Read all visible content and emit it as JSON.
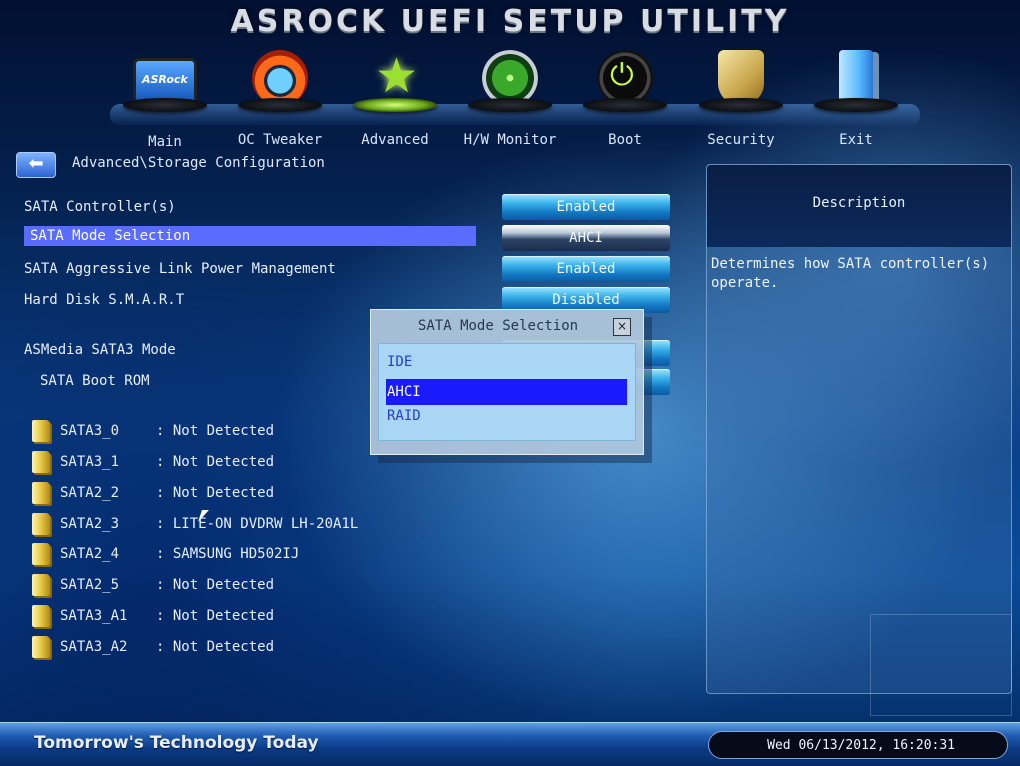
{
  "header": {
    "title": "ASROCK UEFI SETUP UTILITY"
  },
  "nav": [
    {
      "label": "Main",
      "icon": "monitor-icon",
      "badge": "ASRock"
    },
    {
      "label": "OC Tweaker",
      "icon": "speedometer-icon"
    },
    {
      "label": "Advanced",
      "icon": "star-icon",
      "active": true
    },
    {
      "label": "H/W Monitor",
      "icon": "radar-icon"
    },
    {
      "label": "Boot",
      "icon": "power-icon"
    },
    {
      "label": "Security",
      "icon": "shield-icon"
    },
    {
      "label": "Exit",
      "icon": "door-icon"
    }
  ],
  "breadcrumb": "Advanced\\Storage Configuration",
  "settings": [
    {
      "label": "SATA Controller(s)",
      "value": "Enabled"
    },
    {
      "label": "SATA Mode Selection",
      "value": "AHCI"
    },
    {
      "label": "SATA Aggressive Link Power Management",
      "value": "Enabled"
    },
    {
      "label": "Hard Disk S.M.A.R.T",
      "value": "Disabled"
    },
    {
      "label": "ASMedia SATA3 Mode"
    },
    {
      "label": "SATA Boot ROM"
    }
  ],
  "drives": [
    {
      "port": "SATA3_0",
      "status": ": Not Detected"
    },
    {
      "port": "SATA3_1",
      "status": ": Not Detected"
    },
    {
      "port": "SATA2_2",
      "status": ": Not Detected"
    },
    {
      "port": "SATA2_3",
      "status": ": LITE-ON DVDRW LH-20A1L"
    },
    {
      "port": "SATA2_4",
      "status": ": SAMSUNG HD502IJ"
    },
    {
      "port": "SATA2_5",
      "status": ": Not Detected"
    },
    {
      "port": "SATA3_A1",
      "status": ": Not Detected"
    },
    {
      "port": "SATA3_A2",
      "status": ": Not Detected"
    }
  ],
  "popup": {
    "title": "SATA Mode Selection",
    "close": "×",
    "options": [
      "IDE",
      "AHCI",
      "RAID"
    ],
    "selected": "AHCI"
  },
  "description": {
    "title": "Description",
    "text": "Determines how SATA controller(s)\noperate."
  },
  "footer": {
    "tagline": "Tomorrow's Technology Today",
    "datetime": "Wed 06/13/2012, 16:20:31"
  },
  "colors": {
    "selected_row": "#5a6cff",
    "popup_selected": "#1a1aff",
    "value_button": "#3bb3ea"
  }
}
